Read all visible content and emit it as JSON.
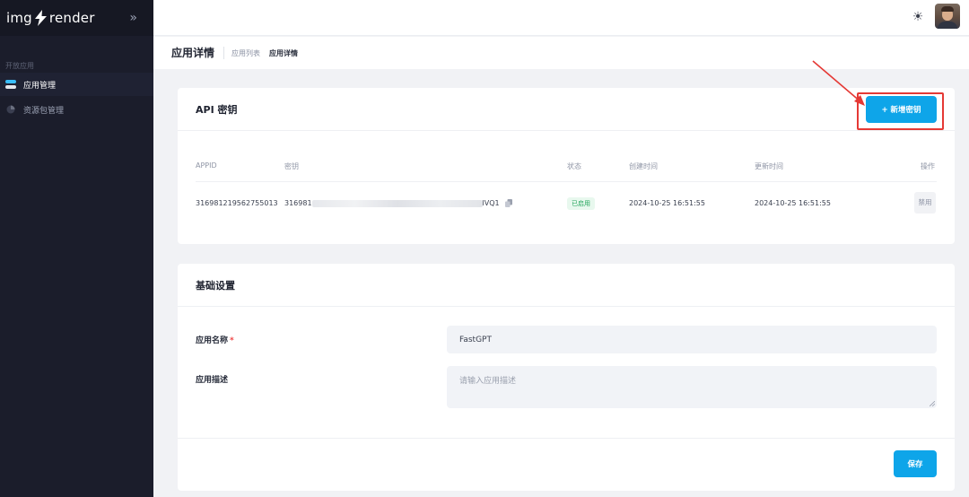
{
  "brand": {
    "left": "img",
    "right": "render"
  },
  "sidebar": {
    "section": "开放应用",
    "items": [
      {
        "label": "应用管理",
        "active": true
      },
      {
        "label": "资源包管理",
        "active": false
      }
    ]
  },
  "header": {
    "page_title": "应用详情",
    "breadcrumb": [
      "应用列表",
      "应用详情"
    ]
  },
  "api_card": {
    "title": "API 密钥",
    "add_button": "+ 新增密钥",
    "columns": [
      "APPID",
      "密钥",
      "状态",
      "创建时间",
      "更新时间",
      "操作"
    ],
    "row": {
      "appid": "316981219562755013",
      "key_prefix": "316981",
      "key_suffix": "lVQ1",
      "status": "已启用",
      "created": "2024-10-25 16:51:55",
      "updated": "2024-10-25 16:51:55",
      "action": "禁用"
    }
  },
  "settings_card": {
    "title": "基础设置",
    "name_label": "应用名称",
    "name_required": "*",
    "name_value": "FastGPT",
    "desc_label": "应用描述",
    "desc_placeholder": "请输入应用描述",
    "save_button": "保存"
  },
  "colors": {
    "primary": "#0ea5e9",
    "sidebar": "#1b1d2b",
    "annotation": "#e53935",
    "success": "#22a55b"
  }
}
